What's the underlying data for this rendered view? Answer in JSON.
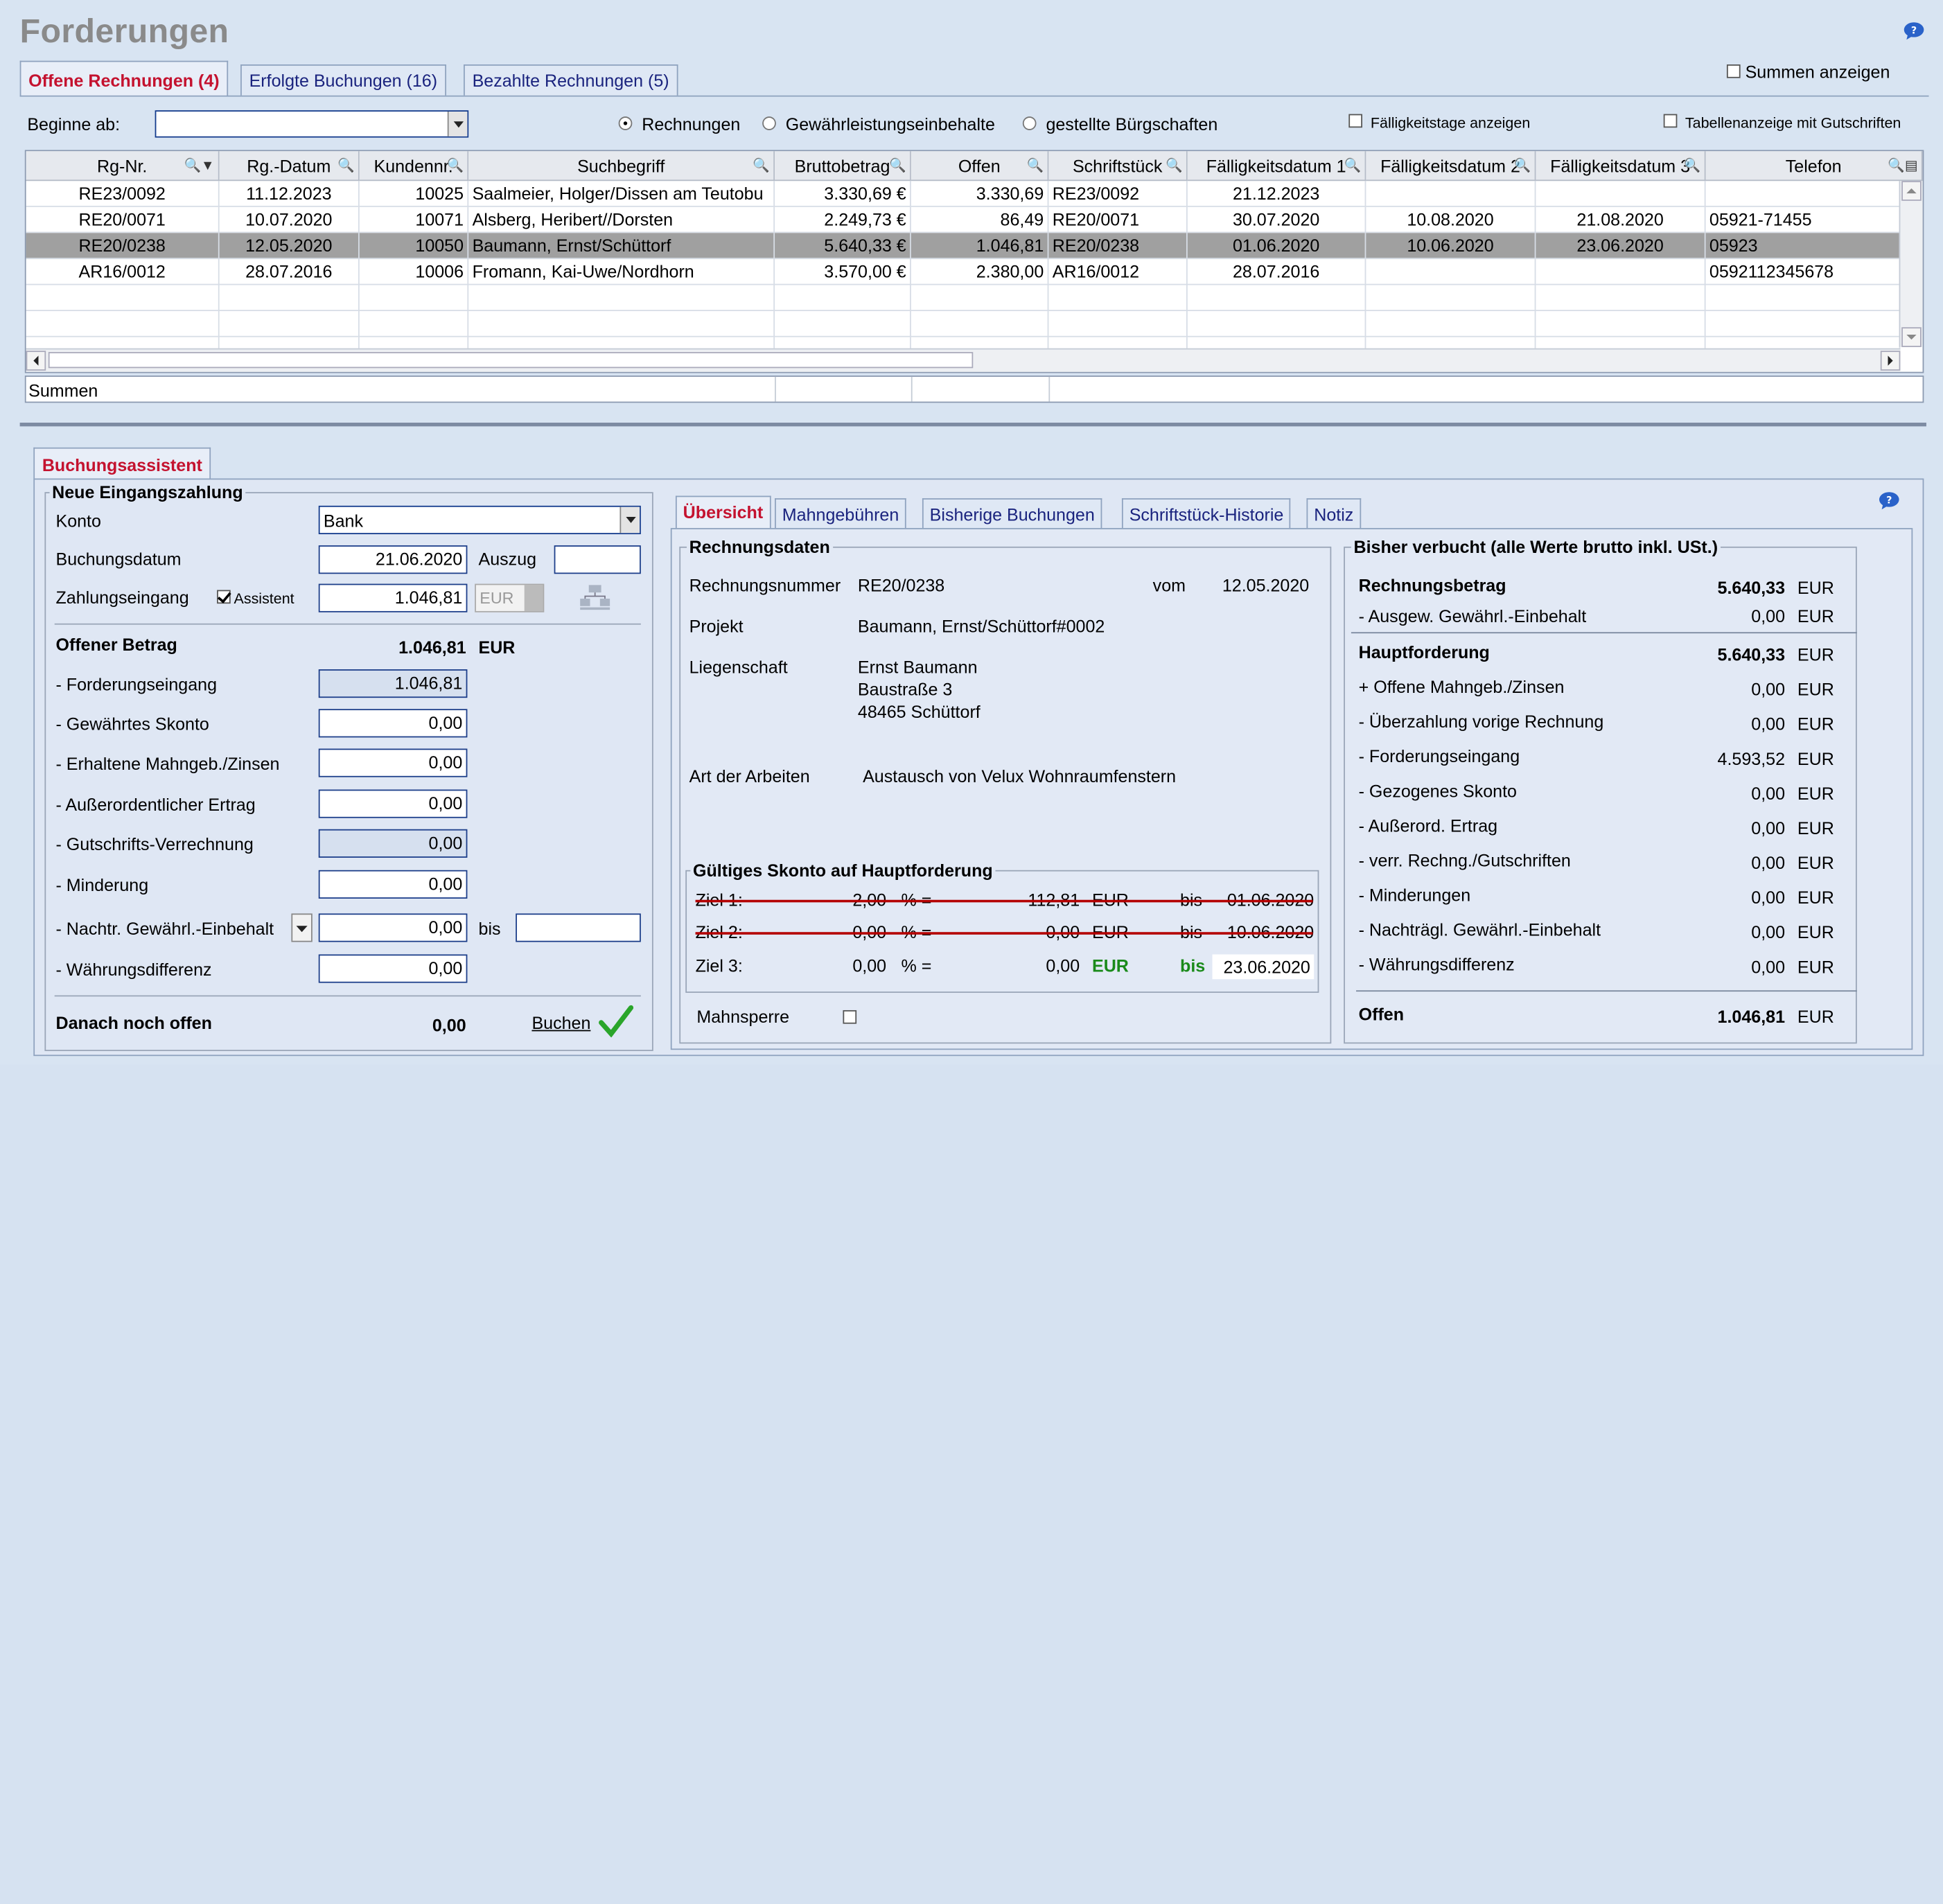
{
  "title": "Forderungen",
  "tabs": [
    {
      "label": "Offene Rechnungen (4)",
      "active": true
    },
    {
      "label": "Erfolgte Buchungen (16)"
    },
    {
      "label": "Bezahlte Rechnungen (5)"
    }
  ],
  "summen_anzeigen": "Summen anzeigen",
  "filter": {
    "beginne_ab": "Beginne ab:",
    "beginne_value": "",
    "radio_rechnungen": "Rechnungen",
    "radio_gewaehr": "Gewährleistungseinbehalte",
    "radio_buergschaften": "gestellte Bürgschaften",
    "faelligkeitstage": "Fälligkeitstage anzeigen",
    "tabellenanzeige": "Tabellenanzeige mit Gutschriften"
  },
  "grid": {
    "columns": [
      "Rg-Nr.",
      "Rg.-Datum",
      "Kundennr.",
      "Suchbegriff",
      "Bruttobetrag",
      "Offen",
      "Schriftstück",
      "Fälligkeitsdatum 1",
      "Fälligkeitsdatum 2",
      "Fälligkeitsdatum 3",
      "Telefon"
    ],
    "rows": [
      {
        "rg": "RE23/0092",
        "datum": "11.12.2023",
        "kunde": "10025",
        "such": "Saalmeier, Holger/Dissen am Teutobu",
        "brutto": "3.330,69 €",
        "offen": "3.330,69",
        "schrift": "RE23/0092",
        "f1": "21.12.2023",
        "f2": "",
        "f3": "",
        "tel": ""
      },
      {
        "rg": "RE20/0071",
        "datum": "10.07.2020",
        "kunde": "10071",
        "such": "Alsberg, Heribert//Dorsten",
        "brutto": "2.249,73 €",
        "offen": "86,49",
        "schrift": "RE20/0071",
        "f1": "30.07.2020",
        "f2": "10.08.2020",
        "f3": "21.08.2020",
        "tel": "05921-71455"
      },
      {
        "rg": "RE20/0238",
        "datum": "12.05.2020",
        "kunde": "10050",
        "such": "Baumann, Ernst/Schüttorf",
        "brutto": "5.640,33 €",
        "offen": "1.046,81",
        "schrift": "RE20/0238",
        "f1": "01.06.2020",
        "f2": "10.06.2020",
        "f3": "23.06.2020",
        "tel": "05923"
      },
      {
        "rg": "AR16/0012",
        "datum": "28.07.2016",
        "kunde": "10006",
        "such": "Fromann, Kai-Uwe/Nordhorn",
        "brutto": "3.570,00 €",
        "offen": "2.380,00",
        "schrift": "AR16/0012",
        "f1": "28.07.2016",
        "f2": "",
        "f3": "",
        "tel": "0592112345678"
      }
    ],
    "summen": "Summen"
  },
  "assistant": {
    "tab": "Buchungsassistent",
    "neue": "Neue Eingangszahlung",
    "konto_label": "Konto",
    "konto_value": "Bank",
    "buchungsdatum_label": "Buchungsdatum",
    "buchungsdatum_value": "21.06.2020",
    "auszug_label": "Auszug",
    "auszug_value": "",
    "zahlung_label": "Zahlungseingang",
    "assistent_label": "Assistent",
    "zahlung_value": "1.046,81",
    "currency": "EUR",
    "offener_label": "Offener Betrag",
    "offener_value": "1.046,81",
    "offener_cur": "EUR",
    "lines": [
      {
        "label": "- Forderungseingang",
        "value": "1.046,81",
        "ro": true
      },
      {
        "label": "- Gewährtes Skonto",
        "value": "0,00"
      },
      {
        "label": "- Erhaltene Mahngeb./Zinsen",
        "value": "0,00"
      },
      {
        "label": "- Außerordentlicher Ertrag",
        "value": "0,00"
      },
      {
        "label": "- Gutschrifts-Verrechnung",
        "value": "0,00",
        "ro": true
      },
      {
        "label": "- Minderung",
        "value": "0,00"
      },
      {
        "label": "- Nachtr. Gewährl.-Einbehalt",
        "value": "0,00"
      },
      {
        "label": "- Währungsdifferenz",
        "value": "0,00"
      }
    ],
    "bis_label": "bis",
    "bis_value": "",
    "danach_label": "Danach noch offen",
    "danach_value": "0,00",
    "buchen_label": "Buchen"
  },
  "subtabs": [
    "Übersicht",
    "Mahngebühren",
    "Bisherige Buchungen",
    "Schriftstück-Historie",
    "Notiz"
  ],
  "rechnungsdaten": {
    "title": "Rechnungsdaten",
    "nummer_label": "Rechnungsnummer",
    "nummer_value": "RE20/0238",
    "vom_label": "vom",
    "vom_value": "12.05.2020",
    "projekt_label": "Projekt",
    "projekt_value": "Baumann, Ernst/Schüttorf#0002",
    "liegenschaft_label": "Liegenschaft",
    "liegenschaft_lines": [
      "Ernst Baumann",
      "Baustraße 3",
      "48465 Schüttorf"
    ],
    "art_label": "Art der Arbeiten",
    "art_value": "Austausch von Velux Wohnraumfenstern"
  },
  "skonto": {
    "title": "Gültiges Skonto auf Hauptforderung",
    "rows": [
      {
        "ziel": "Ziel 1:",
        "pct": "2,00",
        "pct_sign": "% =",
        "amount": "112,81",
        "cur": "EUR",
        "bis": "bis",
        "date": "01.06.2020",
        "struck": true
      },
      {
        "ziel": "Ziel 2:",
        "pct": "0,00",
        "pct_sign": "% =",
        "amount": "0,00",
        "cur": "EUR",
        "bis": "bis",
        "date": "10.06.2020",
        "struck": true
      },
      {
        "ziel": "Ziel 3:",
        "pct": "0,00",
        "pct_sign": "% =",
        "amount": "0,00",
        "cur": "EUR",
        "bis": "bis",
        "date": "23.06.2020",
        "struck": false
      }
    ],
    "mahnsperre": "Mahnsperre"
  },
  "bisher": {
    "title": "Bisher verbucht (alle Werte brutto inkl. USt.)",
    "rechnungsbetrag_label": "Rechnungsbetrag",
    "rechnungsbetrag_value": "5.640,33",
    "ausgew_label": "- Ausgew. Gewährl.-Einbehalt",
    "ausgew_value": "0,00",
    "haupt_label": "Hauptforderung",
    "haupt_value": "5.640,33",
    "lines": [
      {
        "label": "+ Offene Mahngeb./Zinsen",
        "value": "0,00"
      },
      {
        "label": "- Überzahlung vorige Rechnung",
        "value": "0,00"
      },
      {
        "label": "- Forderungseingang",
        "value": "4.593,52"
      },
      {
        "label": "- Gezogenes Skonto",
        "value": "0,00"
      },
      {
        "label": "- Außerord. Ertrag",
        "value": "0,00"
      },
      {
        "label": "- verr. Rechng./Gutschriften",
        "value": "0,00"
      },
      {
        "label": "- Minderungen",
        "value": "0,00"
      },
      {
        "label": "- Nachträgl. Gewährl.-Einbehalt",
        "value": "0,00"
      },
      {
        "label": "- Währungsdifferenz",
        "value": "0,00"
      }
    ],
    "offen_label": "Offen",
    "offen_value": "1.046,81",
    "cur": "EUR"
  }
}
